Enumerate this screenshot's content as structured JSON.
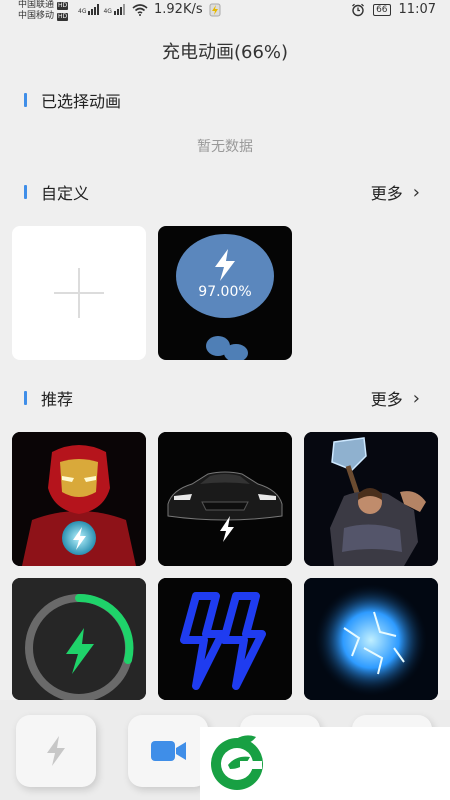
{
  "status_bar": {
    "carrier_1": "中国联通",
    "carrier_2": "中国移动",
    "hd_badge": "HD",
    "net_type": "4G",
    "speed": "1.92K/s",
    "battery": "66",
    "time": "11:07"
  },
  "page": {
    "title": "充电动画(66%)"
  },
  "sections": {
    "selected": {
      "label": "已选择动画",
      "empty": "暂无数据"
    },
    "custom": {
      "label": "自定义",
      "more": "更多"
    },
    "recommended": {
      "label": "推荐",
      "more": "更多"
    }
  },
  "custom_tiles": {
    "preview_percent": "97.00%"
  },
  "recommended_tiles": [
    {
      "name": "iron-man"
    },
    {
      "name": "car"
    },
    {
      "name": "thor"
    },
    {
      "name": "green-ring"
    },
    {
      "name": "blue-bolts"
    },
    {
      "name": "energy-orb"
    }
  ],
  "bottom_nav": [
    {
      "icon": "bolt-icon"
    },
    {
      "icon": "video-icon"
    },
    {
      "icon": ""
    },
    {
      "icon": ""
    }
  ],
  "colors": {
    "accent": "#3f8ee8",
    "background": "#efefef",
    "circle_blue": "#5b87bd",
    "ring_green": "#1fd36a",
    "bolt_blue": "#1f3cf0",
    "logo_green": "#18a043"
  }
}
